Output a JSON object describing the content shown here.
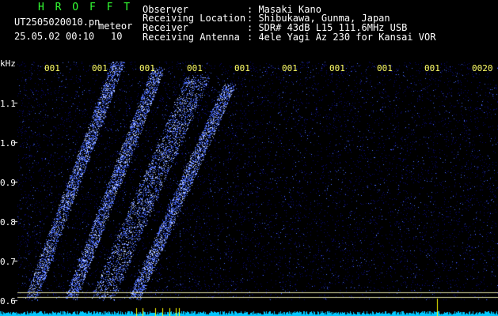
{
  "header": {
    "app_name": "H R O F F T",
    "file_name": "UT2505020010.pn",
    "category": "meteor",
    "datetime": "25.05.02 00:10",
    "duration": "10",
    "fields": [
      {
        "label": "Observer",
        "value": ": Masaki Kano"
      },
      {
        "label": "Receiving Location",
        "value": ": Shibukawa, Gunma, Japan"
      },
      {
        "label": "Receiver",
        "value": ": SDR# 43dB L15 111.6MHz USB"
      },
      {
        "label": "Receiving Antenna",
        "value": ": 4ele Yagi Az 230 for Kansai VOR"
      }
    ]
  },
  "y_axis": {
    "unit": "kHz",
    "ticks": [
      "1.1",
      "1.0",
      "0.9",
      "0.8",
      "0.7",
      "0.6"
    ]
  },
  "x_axis": {
    "ticks": [
      "001",
      "001",
      "001",
      "001",
      "001",
      "001",
      "001",
      "001",
      "001",
      "0020"
    ]
  },
  "colors": {
    "background": "#000000",
    "noise": "#0a0a6e",
    "signal": "#4a6cff",
    "bright": "#c8d8ff",
    "baseline": "#00c8ff",
    "marker": "#ffff00",
    "ref_line": "#d8d8a0"
  }
}
